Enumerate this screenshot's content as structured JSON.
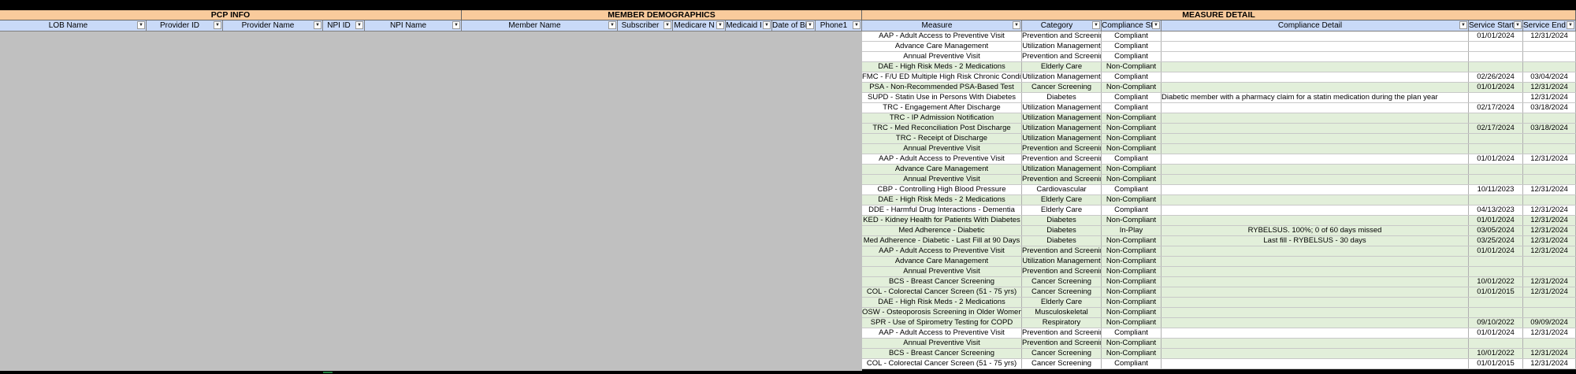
{
  "group_headers": {
    "pcp_info": "PCP INFO",
    "member_demographics": "MEMBER DEMOGRAPHICS",
    "measure_detail": "MEASURE DETAIL"
  },
  "columns": {
    "lob_name": "LOB Name",
    "provider_id": "Provider ID",
    "provider_name": "Provider Name",
    "npi_id": "NPI ID",
    "npi_name": "NPI Name",
    "member_name": "Member Name",
    "subscriber": "Subscriber",
    "medicare": "Medicare N",
    "medicaid": "Medicaid I",
    "dob": "Date of Bi",
    "phone": "Phone1",
    "measure": "Measure",
    "category": "Category",
    "compliance_status": "Compliance Sta",
    "compliance_detail": "Compliance Detail",
    "service_start": "Service Start Da",
    "service_end": "Service End D"
  },
  "filter_icon": "dropdown-arrow-icon",
  "colors": {
    "group_header": "#f9cb9c",
    "column_header": "#c9daf8",
    "alt_row": "#e2efda",
    "redacted": "#c0c0c0"
  },
  "rows": [
    {
      "measure": "AAP - Adult Access to Preventive Visit",
      "category": "Prevention and Screening",
      "status": "Compliant",
      "detail": "",
      "start": "01/01/2024",
      "end": "12/31/2024",
      "alt": false
    },
    {
      "measure": "Advance Care Management",
      "category": "Utilization Management",
      "status": "Compliant",
      "detail": "",
      "start": "",
      "end": "",
      "alt": false
    },
    {
      "measure": "Annual Preventive Visit",
      "category": "Prevention and Screening",
      "status": "Compliant",
      "detail": "",
      "start": "",
      "end": "",
      "alt": false
    },
    {
      "measure": "DAE - High Risk Meds - 2 Medications",
      "category": "Elderly Care",
      "status": "Non-Compliant",
      "detail": "",
      "start": "",
      "end": "",
      "alt": true
    },
    {
      "measure": "FMC - F/U ED Multiple High Risk Chronic Conditions",
      "category": "Utilization Management",
      "status": "Compliant",
      "detail": "",
      "start": "02/26/2024",
      "end": "03/04/2024",
      "alt": false
    },
    {
      "measure": "PSA - Non-Recommended PSA-Based Test",
      "category": "Cancer Screening",
      "status": "Non-Compliant",
      "detail": "",
      "start": "01/01/2024",
      "end": "12/31/2024",
      "alt": true
    },
    {
      "measure": "SUPD - Statin Use in Persons With Diabetes",
      "category": "Diabetes",
      "status": "Compliant",
      "detail": "Diabetic member with a pharmacy claim for a statin medication during the plan year",
      "start": "",
      "end": "12/31/2024",
      "alt": false,
      "detail_left": true
    },
    {
      "measure": "TRC - Engagement After Discharge",
      "category": "Utilization Management",
      "status": "Compliant",
      "detail": "",
      "start": "02/17/2024",
      "end": "03/18/2024",
      "alt": false
    },
    {
      "measure": "TRC - IP Admission Notification",
      "category": "Utilization Management",
      "status": "Non-Compliant",
      "detail": "",
      "start": "",
      "end": "",
      "alt": true
    },
    {
      "measure": "TRC - Med Reconciliation Post Discharge",
      "category": "Utilization Management",
      "status": "Non-Compliant",
      "detail": "",
      "start": "02/17/2024",
      "end": "03/18/2024",
      "alt": true
    },
    {
      "measure": "TRC - Receipt of Discharge",
      "category": "Utilization Management",
      "status": "Non-Compliant",
      "detail": "",
      "start": "",
      "end": "",
      "alt": true
    },
    {
      "measure": "Annual Preventive Visit",
      "category": "Prevention and Screening",
      "status": "Non-Compliant",
      "detail": "",
      "start": "",
      "end": "",
      "alt": true
    },
    {
      "measure": "AAP - Adult Access to Preventive Visit",
      "category": "Prevention and Screening",
      "status": "Compliant",
      "detail": "",
      "start": "01/01/2024",
      "end": "12/31/2024",
      "alt": false
    },
    {
      "measure": "Advance Care Management",
      "category": "Utilization Management",
      "status": "Non-Compliant",
      "detail": "",
      "start": "",
      "end": "",
      "alt": true
    },
    {
      "measure": "Annual Preventive Visit",
      "category": "Prevention and Screening",
      "status": "Non-Compliant",
      "detail": "",
      "start": "",
      "end": "",
      "alt": true
    },
    {
      "measure": "CBP - Controlling High Blood Pressure",
      "category": "Cardiovascular",
      "status": "Compliant",
      "detail": "",
      "start": "10/11/2023",
      "end": "12/31/2024",
      "alt": false
    },
    {
      "measure": "DAE - High Risk Meds - 2 Medications",
      "category": "Elderly Care",
      "status": "Non-Compliant",
      "detail": "",
      "start": "",
      "end": "",
      "alt": true
    },
    {
      "measure": "DDE - Harmful Drug Interactions - Dementia",
      "category": "Elderly Care",
      "status": "Compliant",
      "detail": "",
      "start": "04/13/2023",
      "end": "12/31/2024",
      "alt": false
    },
    {
      "measure": "KED - Kidney Health for Patients With Diabetes",
      "category": "Diabetes",
      "status": "Non-Compliant",
      "detail": "",
      "start": "01/01/2024",
      "end": "12/31/2024",
      "alt": true
    },
    {
      "measure": "Med Adherence - Diabetic",
      "category": "Diabetes",
      "status": "In-Play",
      "detail": "RYBELSUS. 100%;   0 of 60 days missed",
      "start": "03/05/2024",
      "end": "12/31/2024",
      "alt": true
    },
    {
      "measure": "Med Adherence - Diabetic - Last Fill at 90 Days",
      "category": "Diabetes",
      "status": "Non-Compliant",
      "detail": "Last fill - RYBELSUS -  30 days",
      "start": "03/25/2024",
      "end": "12/31/2024",
      "alt": true
    },
    {
      "measure": "AAP - Adult Access to Preventive Visit",
      "category": "Prevention and Screening",
      "status": "Non-Compliant",
      "detail": "",
      "start": "01/01/2024",
      "end": "12/31/2024",
      "alt": true
    },
    {
      "measure": "Advance Care Management",
      "category": "Utilization Management",
      "status": "Non-Compliant",
      "detail": "",
      "start": "",
      "end": "",
      "alt": true
    },
    {
      "measure": "Annual Preventive Visit",
      "category": "Prevention and Screening",
      "status": "Non-Compliant",
      "detail": "",
      "start": "",
      "end": "",
      "alt": true
    },
    {
      "measure": "BCS - Breast Cancer Screening",
      "category": "Cancer Screening",
      "status": "Non-Compliant",
      "detail": "",
      "start": "10/01/2022",
      "end": "12/31/2024",
      "alt": true
    },
    {
      "measure": "COL - Colorectal Cancer Screen (51 - 75 yrs)",
      "category": "Cancer Screening",
      "status": "Non-Compliant",
      "detail": "",
      "start": "01/01/2015",
      "end": "12/31/2024",
      "alt": true
    },
    {
      "measure": "DAE - High Risk Meds - 2 Medications",
      "category": "Elderly Care",
      "status": "Non-Compliant",
      "detail": "",
      "start": "",
      "end": "",
      "alt": true
    },
    {
      "measure": "OSW - Osteoporosis Screening in Older Women",
      "category": "Musculoskeletal",
      "status": "Non-Compliant",
      "detail": "",
      "start": "",
      "end": "",
      "alt": true
    },
    {
      "measure": "SPR - Use of Spirometry Testing for COPD",
      "category": "Respiratory",
      "status": "Non-Compliant",
      "detail": "",
      "start": "09/10/2022",
      "end": "09/09/2024",
      "alt": true
    },
    {
      "measure": "AAP - Adult Access to Preventive Visit",
      "category": "Prevention and Screening",
      "status": "Compliant",
      "detail": "",
      "start": "01/01/2024",
      "end": "12/31/2024",
      "alt": false
    },
    {
      "measure": "Annual Preventive Visit",
      "category": "Prevention and Screening",
      "status": "Non-Compliant",
      "detail": "",
      "start": "",
      "end": "",
      "alt": true
    },
    {
      "measure": "BCS - Breast Cancer Screening",
      "category": "Cancer Screening",
      "status": "Non-Compliant",
      "detail": "",
      "start": "10/01/2022",
      "end": "12/31/2024",
      "alt": true
    },
    {
      "measure": "COL - Colorectal Cancer Screen (51 - 75 yrs)",
      "category": "Cancer Screening",
      "status": "Compliant",
      "detail": "",
      "start": "01/01/2015",
      "end": "12/31/2024",
      "alt": false
    }
  ]
}
